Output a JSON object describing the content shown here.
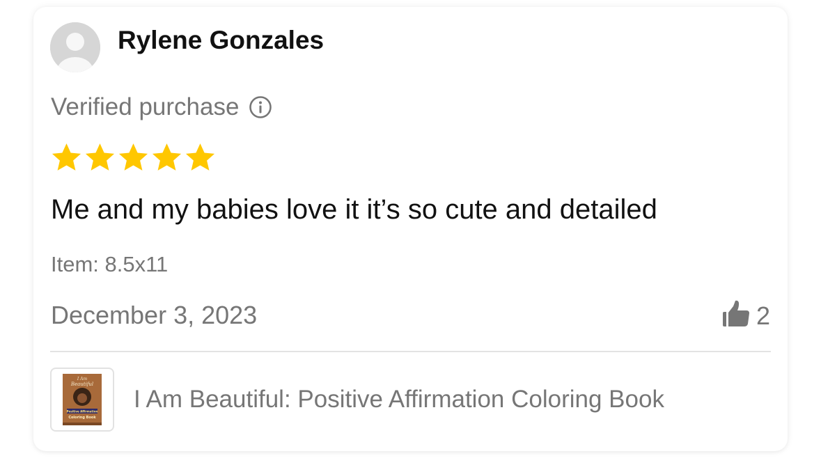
{
  "review": {
    "reviewer_name": "Rylene Gonzales",
    "verified_label": "Verified purchase",
    "rating": 5,
    "rating_max": 5,
    "star_color": "#FFC700",
    "text": "Me and my babies love it it’s so cute and detailed",
    "item_variant": "Item: 8.5x11",
    "date": "December 3, 2023",
    "helpful_count": "2"
  },
  "product": {
    "title": "I Am Beautiful: Positive Affirmation Coloring Book",
    "thumbnail_texts": [
      "I Am",
      "Beautiful",
      "Positive Affirmation",
      "Coloring Book"
    ]
  },
  "icons": {
    "avatar": "default-avatar-icon",
    "info": "info-circle-icon",
    "star": "star-icon",
    "helpful": "thumbs-up-icon"
  }
}
